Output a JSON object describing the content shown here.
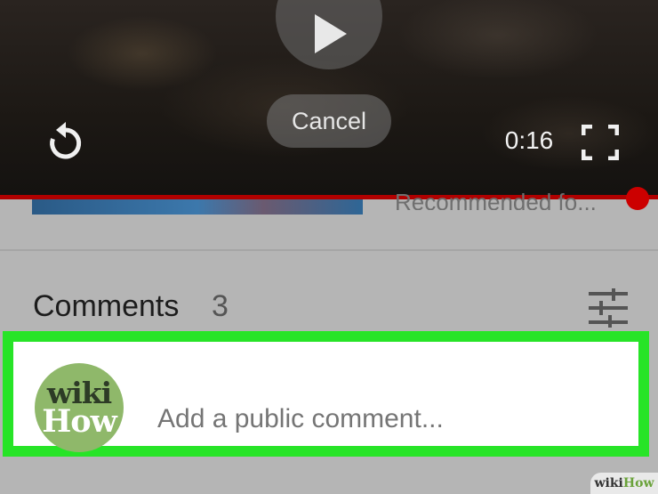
{
  "video": {
    "cancel_label": "Cancel",
    "elapsed_time": "0:16",
    "progress_fraction": 0.97
  },
  "recommended": {
    "text": "Recommended fo..."
  },
  "comments": {
    "label": "Comments",
    "count": "3",
    "input_placeholder": "Add a public comment..."
  },
  "avatar": {
    "line1": "wiki",
    "line2": "How"
  },
  "watermark": {
    "part1": "wiki",
    "part2": "How"
  },
  "colors": {
    "highlight": "#27e427",
    "progress": "#cc0000",
    "avatar_bg": "#8fb86a"
  },
  "icons": [
    "play-icon",
    "replay-icon",
    "fullscreen-icon",
    "sort-icon"
  ]
}
